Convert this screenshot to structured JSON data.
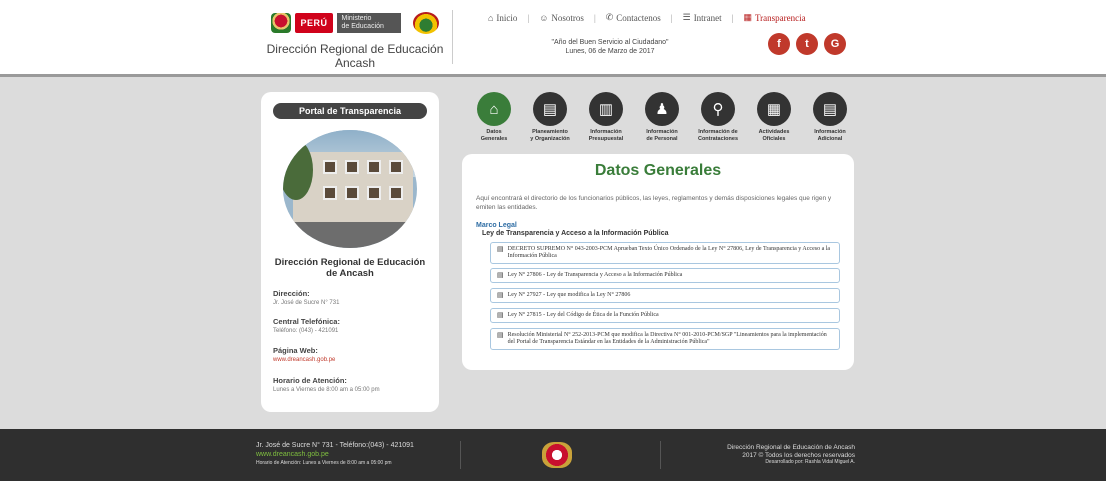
{
  "header": {
    "peru": "PERÚ",
    "ministerio_line1": "Ministerio",
    "ministerio_line2": "de Educación",
    "org_name": "Dirección Regional de Educación Ancash",
    "slogan_line1": "\"Año del Buen Servicio al Ciudadano\"",
    "slogan_line2": "Lunes, 06 de Marzo de 2017",
    "nav": [
      {
        "icon": "home-icon",
        "glyph": "⌂",
        "label": "Inicio"
      },
      {
        "icon": "group-icon",
        "glyph": "☺",
        "label": "Nosotros"
      },
      {
        "icon": "phone-icon",
        "glyph": "✆",
        "label": "Contactenos"
      },
      {
        "icon": "list-icon",
        "glyph": "☰",
        "label": "Intranet"
      },
      {
        "icon": "building-icon",
        "glyph": "▦",
        "label": "Transparencia"
      }
    ],
    "social": [
      {
        "icon": "facebook-icon",
        "glyph": "f"
      },
      {
        "icon": "twitter-icon",
        "glyph": "t"
      },
      {
        "icon": "google-icon",
        "glyph": "G"
      }
    ],
    "colors": {
      "accent_red": "#c0392b",
      "green": "#3a7d3a"
    }
  },
  "sidebar": {
    "portal_title": "Portal de Transparencia",
    "org_name": "Dirección Regional de Educación de Ancash",
    "direccion_label": "Dirección:",
    "direccion_value": "Jr. José de Sucre N° 731",
    "telefono_label": "Central Telefónica:",
    "telefono_value": "Teléfono: (043) - 421091",
    "web_label": "Página Web:",
    "web_value": "www.dreancash.gob.pe",
    "horario_label": "Horario de Atención:",
    "horario_value": "Lunes a Viernes de 8:00 am a 05:00 pm"
  },
  "categories": [
    {
      "icon": "home-icon",
      "glyph": "⌂",
      "line1": "Datos",
      "line2": "Generales",
      "active": true
    },
    {
      "icon": "book-icon",
      "glyph": "▤",
      "line1": "Planeamiento",
      "line2": "y Organización"
    },
    {
      "icon": "bar-chart-icon",
      "glyph": "▥",
      "line1": "Información",
      "line2": "Presupuestal"
    },
    {
      "icon": "person-icon",
      "glyph": "♟",
      "line1": "Información",
      "line2": "de Personal"
    },
    {
      "icon": "search-icon",
      "glyph": "⚲",
      "line1": "Información de",
      "line2": "Contrataciones"
    },
    {
      "icon": "calendar-icon",
      "glyph": "▦",
      "line1": "Actividades",
      "line2": "Oficiales"
    },
    {
      "icon": "document-icon",
      "glyph": "▤",
      "line1": "Información",
      "line2": "Adicional"
    }
  ],
  "content": {
    "title": "Datos Generales",
    "intro": "Aquí encontrará el directorio de los funcionarios públicos, las leyes, reglamentos y demás disposiciones legales que rigen y emiten las entidades.",
    "marco_legal": "Marco Legal",
    "ley_title": "Ley de Transparencia y Acceso a la Información Pública",
    "documents": [
      "DECRETO SUPREMO N° 043-2003-PCM Aprueban Texto Único Ordenado de la Ley N° 27806, Ley de Transparencia y Acceso a la Información Pública",
      "Ley N° 27806 - Ley de Transparencia y Acceso a la Información Pública",
      "Ley N° 27927 - Ley que modifica la Ley N° 27806",
      "Ley N° 27815 - Ley del Código de Ética de la Función Pública",
      "Resolución Ministerial N° 252-2013-PCM que modifica la Directiva N° 001-2010-PCM/SGP \"Lineamientos para la implementación del Portal de Transparencia Estándar en las Entidades de la Administración Pública\""
    ]
  },
  "footer": {
    "address": "Jr. José de Sucre N° 731 - Teléfono:(043) - 421091",
    "web": "www.dreancash.gob.pe",
    "horario": "Horario de Atención: Lunes a Viernes de 8:00 am a 05:00 pm",
    "org": "Dirección Regional de Educación de Ancash",
    "copyright": "2017 © Todos los derechos reservados",
    "developer": "Desarrollado por: Rashla Vidal Miguel A."
  }
}
